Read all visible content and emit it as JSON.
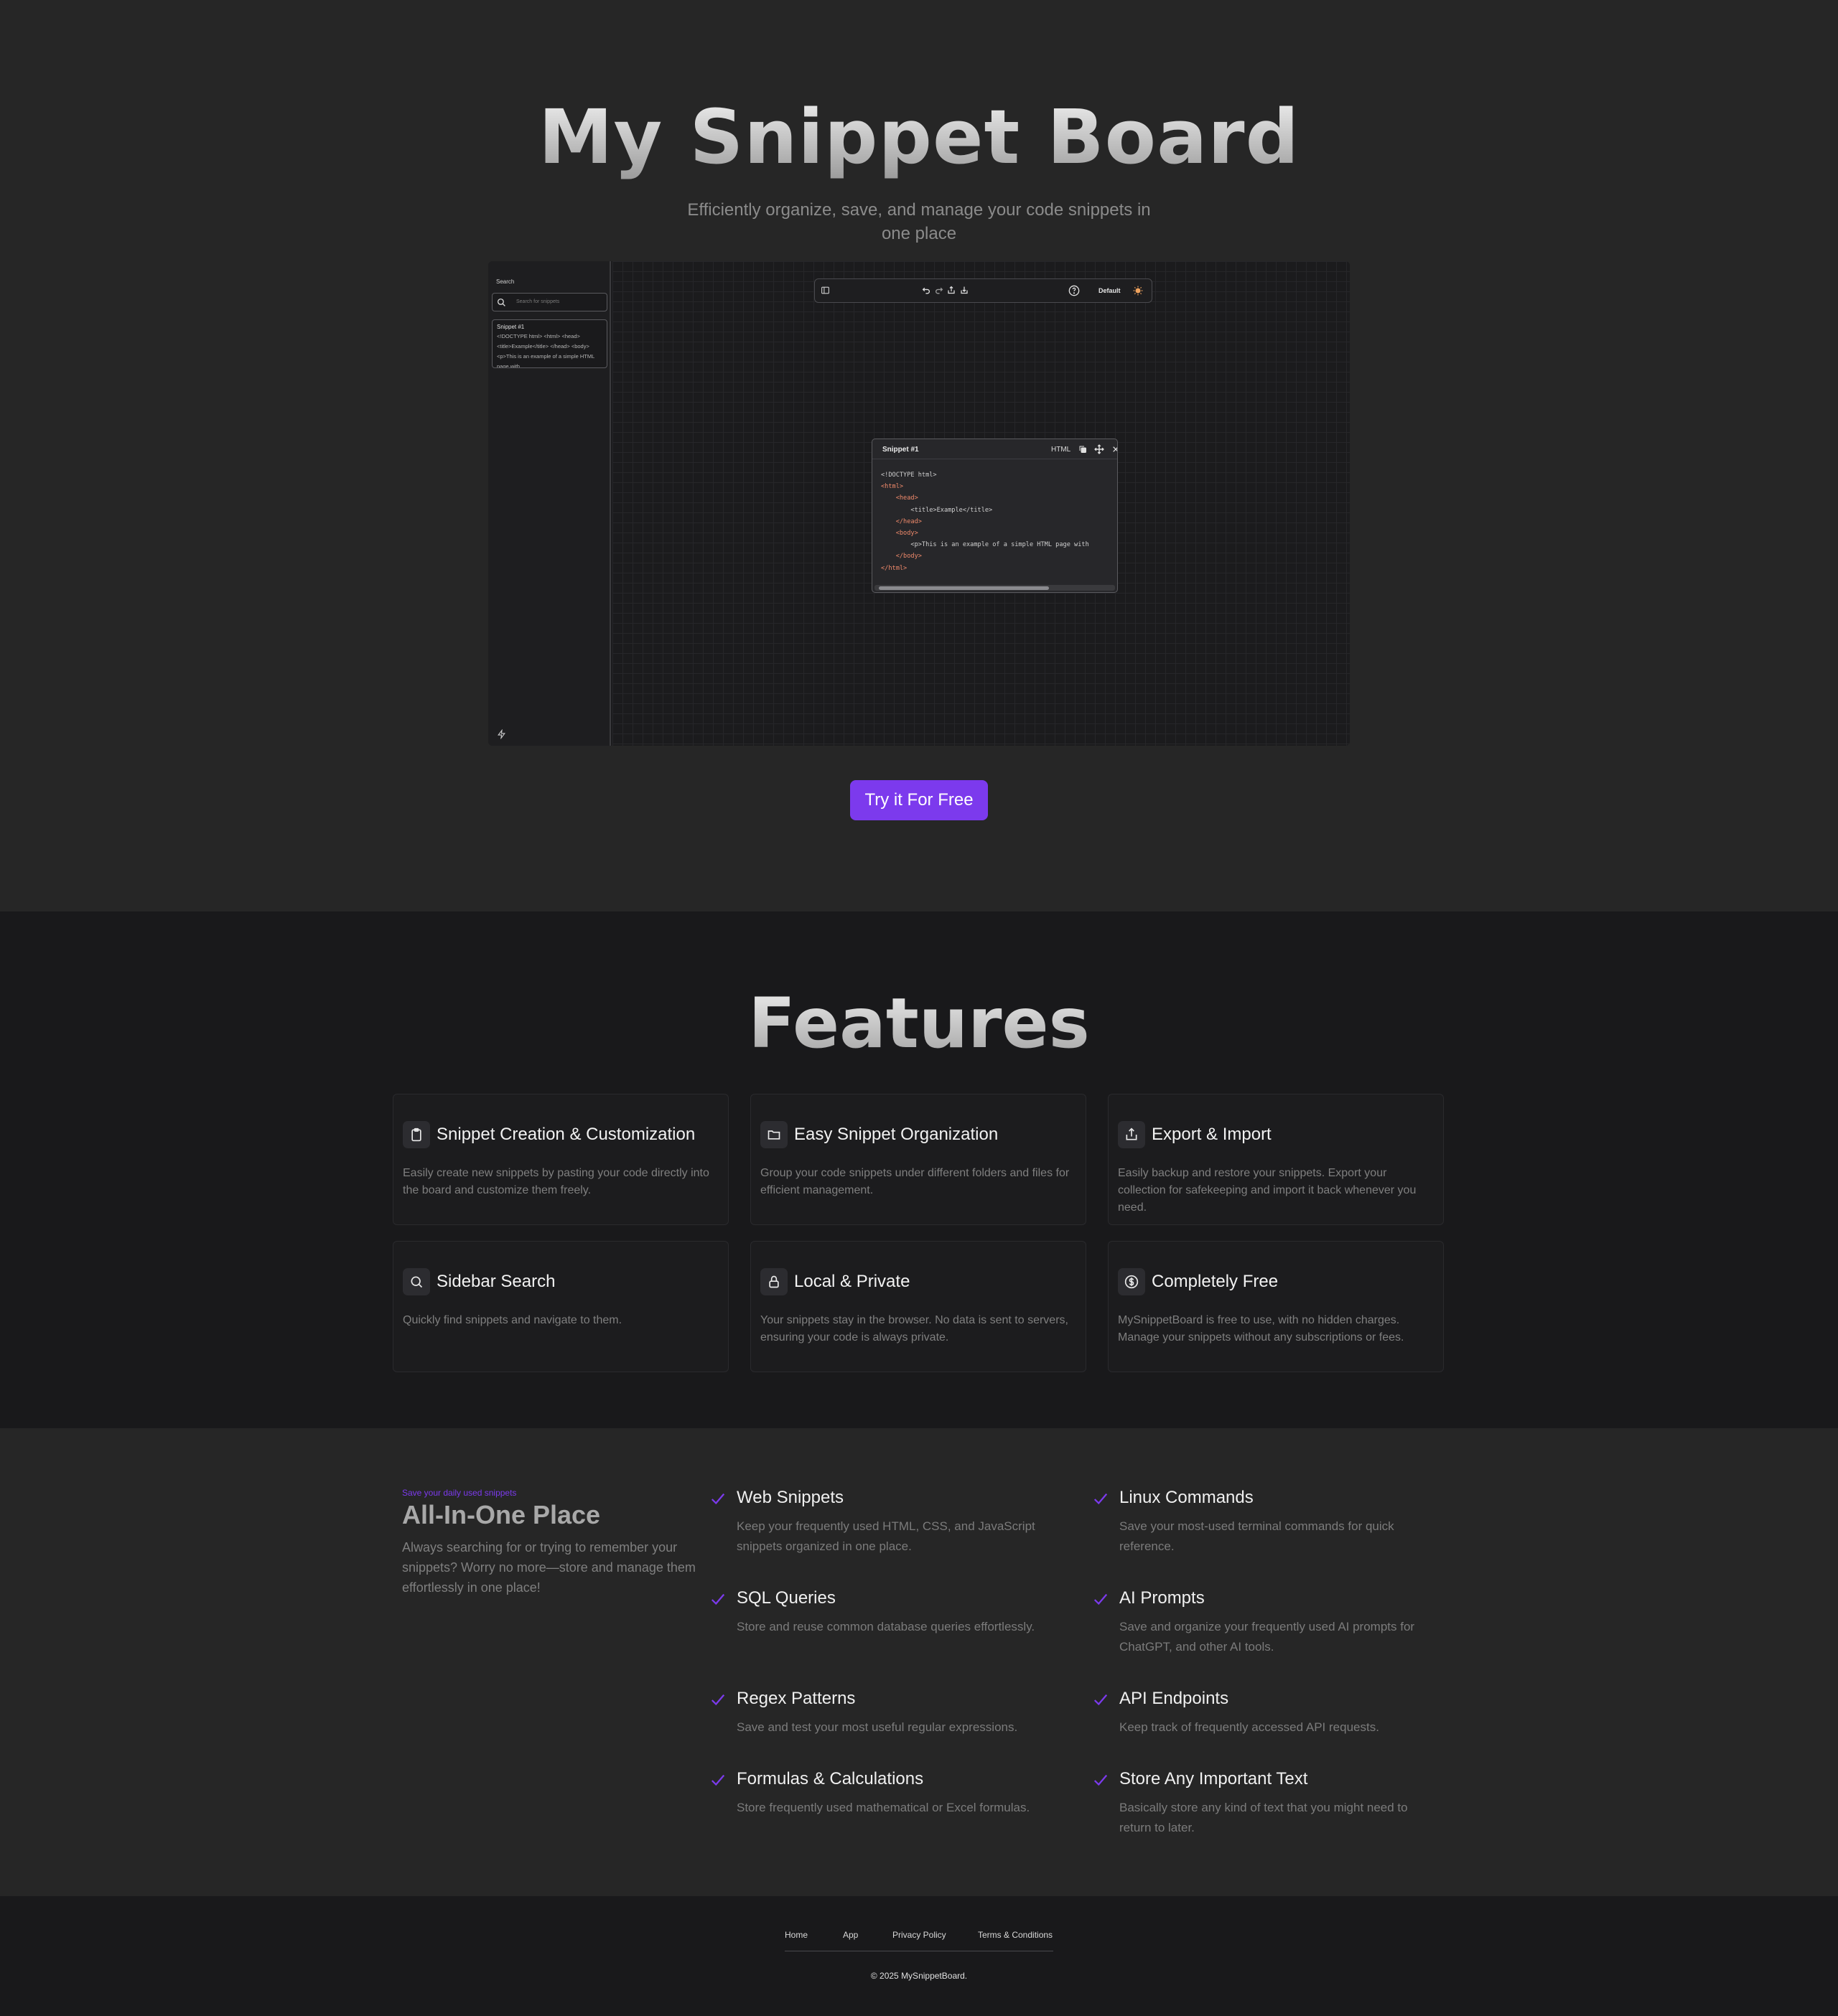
{
  "hero": {
    "title": "My Snippet Board",
    "subtitle": "Efficiently organize, save, and manage your code snippets in one place",
    "cta_label": "Try it For Free"
  },
  "preview": {
    "search_label": "Search",
    "search_placeholder": "Search for snippets",
    "sidebar_snippet_title": "Snippet #1",
    "sidebar_snippet_preview": "<!DOCTYPE html> <html> <head> <title>Example</title> </head> <body> <p>This is an example of a simple HTML page with",
    "toolbar_theme_label": "Default",
    "snippet_title": "Snippet #1",
    "snippet_language": "HTML",
    "code_lines": [
      "<!DOCTYPE html>",
      "<html>",
      "    <head>",
      "        <title>Example</title>",
      "    </head>",
      "    <body>",
      "        <p>This is an example of a simple HTML page with",
      "    </body>",
      "</html>"
    ],
    "accent_color": "#f0a35e"
  },
  "features": {
    "title": "Features",
    "items": [
      {
        "icon": "clipboard-icon",
        "title": "Snippet Creation & Customization",
        "desc": "Easily create new snippets by pasting your code directly into the board and customize them freely."
      },
      {
        "icon": "folder-icon",
        "title": "Easy Snippet Organization",
        "desc": "Group your code snippets under different folders and files for efficient management."
      },
      {
        "icon": "share-icon",
        "title": "Export & Import",
        "desc": "Easily backup and restore your snippets. Export your collection for safekeeping and import it back whenever you need."
      },
      {
        "icon": "search-icon",
        "title": "Sidebar Search",
        "desc": "Quickly find snippets and navigate to them."
      },
      {
        "icon": "lock-icon",
        "title": "Local & Private",
        "desc": "Your snippets stay in the browser. No data is sent to servers, ensuring your code is always private."
      },
      {
        "icon": "dollar-icon",
        "title": "Completely Free",
        "desc": "MySnippetBoard is free to use, with no hidden charges. Manage your snippets without any subscriptions or fees."
      }
    ]
  },
  "all_in_one": {
    "kicker": "Save your daily used snippets",
    "title": "All-In-One Place",
    "desc": "Always searching for or trying to remember your snippets? Worry no more—store and manage them effortlessly in one place!",
    "check_color": "#7c3aed",
    "items": [
      {
        "title": "Web Snippets",
        "desc": "Keep your frequently used HTML, CSS, and JavaScript snippets organized in one place."
      },
      {
        "title": "Linux Commands",
        "desc": "Save your most-used terminal commands for quick reference."
      },
      {
        "title": "SQL Queries",
        "desc": "Store and reuse common database queries effortlessly."
      },
      {
        "title": "AI Prompts",
        "desc": "Save and organize your frequently used AI prompts for ChatGPT, and other AI tools."
      },
      {
        "title": "Regex Patterns",
        "desc": "Save and test your most useful regular expressions."
      },
      {
        "title": "API Endpoints",
        "desc": "Keep track of frequently accessed API requests."
      },
      {
        "title": "Formulas & Calculations",
        "desc": "Store frequently used mathematical or Excel formulas."
      },
      {
        "title": "Store Any Important Text",
        "desc": "Basically store any kind of text that you might need to return to later."
      }
    ]
  },
  "footer": {
    "links": [
      "Home",
      "App",
      "Privacy Policy",
      "Terms & Conditions"
    ],
    "copyright": "© 2025 MySnippetBoard."
  },
  "colors": {
    "brand": "#7c3aed",
    "background": "#262626",
    "section_dark": "#19191b"
  }
}
